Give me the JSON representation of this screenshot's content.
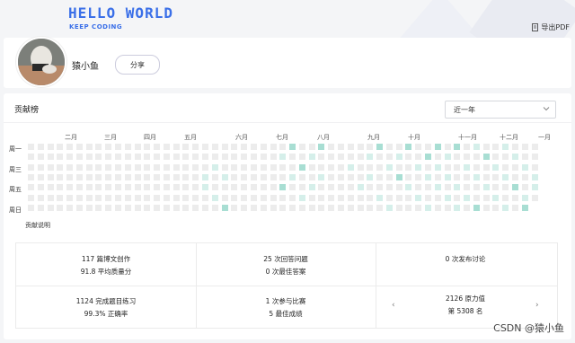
{
  "banner": {
    "title": "HELLO WORLD",
    "subtitle": "KEEP CODING",
    "export_label": "导出PDF"
  },
  "profile": {
    "username": "猿小鱼",
    "share_label": "分享"
  },
  "contributions": {
    "title": "贡献榜",
    "period_select": "近一年",
    "months": [
      "二月",
      "三月",
      "四月",
      "五月",
      "六月",
      "七月",
      "八月",
      "九月",
      "十月",
      "十一月",
      "十二月",
      "一月"
    ],
    "day_labels": [
      "周一",
      "周三",
      "周五",
      "周日"
    ],
    "legend": "贡献说明",
    "colors": {
      "empty": "#ececec",
      "light": "#d5efea",
      "mid": "#a8ded3"
    }
  },
  "stats": {
    "row1": [
      {
        "line1": "117 篇博文创作",
        "line2": "91.8 平均质量分"
      },
      {
        "line1": "25 次回答问题",
        "line2": "0 次最佳答案"
      },
      {
        "line1": "0 次发布讨论",
        "line2": ""
      }
    ],
    "row2": [
      {
        "line1": "1124 完成题目练习",
        "line2": "99.3% 正确率"
      },
      {
        "line1": "1 次参与比赛",
        "line2": "5 最佳成绩"
      },
      {
        "line1": "2126 原力值",
        "line2": "第 5308 名"
      }
    ]
  },
  "watermark": "CSDN @猿小鱼"
}
